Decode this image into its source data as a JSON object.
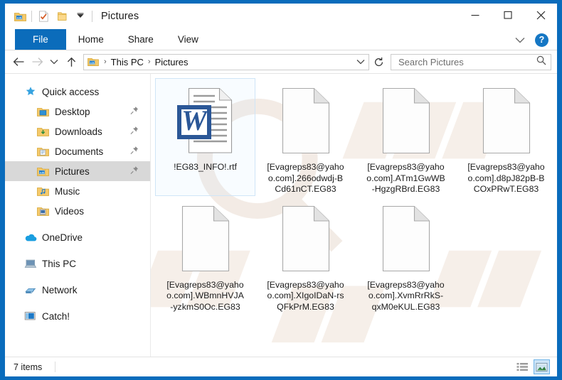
{
  "window": {
    "title": "Pictures",
    "controls": {
      "minimize": "minimize-icon",
      "maximize": "maximize-icon",
      "close": "close-icon"
    },
    "quick_access_toolbar": [
      {
        "name": "pictures-folder-icon",
        "label": "Pictures"
      },
      {
        "name": "properties-icon",
        "label": "Properties"
      },
      {
        "name": "new-folder-icon",
        "label": "New folder"
      },
      {
        "name": "customize-dropdown-icon",
        "label": "Customize Quick Access Toolbar"
      }
    ]
  },
  "ribbon": {
    "tabs": [
      {
        "label": "File",
        "active": true
      },
      {
        "label": "Home",
        "active": false
      },
      {
        "label": "Share",
        "active": false
      },
      {
        "label": "View",
        "active": false
      }
    ],
    "collapse_icon": "chevron-down-icon",
    "help_label": "?"
  },
  "navigation": {
    "back_icon": "arrow-left-icon",
    "forward_icon": "arrow-right-icon",
    "recent_icon": "chevron-down-icon",
    "up_icon": "arrow-up-icon",
    "refresh_icon": "refresh-icon",
    "dropdown_icon": "chevron-down-icon",
    "breadcrumb": [
      {
        "label": "This PC"
      },
      {
        "label": "Pictures"
      }
    ],
    "separator": "›"
  },
  "search": {
    "placeholder": "Search Pictures",
    "value": "",
    "icon": "search-icon"
  },
  "sidebar": {
    "items": [
      {
        "label": "Quick access",
        "icon": "star-icon",
        "indent": false,
        "pinned": false,
        "selected": false
      },
      {
        "label": "Desktop",
        "icon": "desktop-folder-icon",
        "indent": true,
        "pinned": true,
        "selected": false
      },
      {
        "label": "Downloads",
        "icon": "downloads-folder-icon",
        "indent": true,
        "pinned": true,
        "selected": false
      },
      {
        "label": "Documents",
        "icon": "documents-folder-icon",
        "indent": true,
        "pinned": true,
        "selected": false
      },
      {
        "label": "Pictures",
        "icon": "pictures-folder-icon",
        "indent": true,
        "pinned": true,
        "selected": true
      },
      {
        "label": "Music",
        "icon": "music-folder-icon",
        "indent": true,
        "pinned": false,
        "selected": false
      },
      {
        "label": "Videos",
        "icon": "videos-folder-icon",
        "indent": true,
        "pinned": false,
        "selected": false
      },
      {
        "label": "OneDrive",
        "icon": "onedrive-cloud-icon",
        "indent": false,
        "pinned": false,
        "selected": false,
        "gap_before": true
      },
      {
        "label": "This PC",
        "icon": "this-pc-icon",
        "indent": false,
        "pinned": false,
        "selected": false,
        "gap_before": true
      },
      {
        "label": "Network",
        "icon": "network-icon",
        "indent": false,
        "pinned": false,
        "selected": false,
        "gap_before": true
      },
      {
        "label": "Catch!",
        "icon": "catch-media-icon",
        "indent": false,
        "pinned": false,
        "selected": false,
        "gap_before": true
      }
    ]
  },
  "files": [
    {
      "name": "!EG83_INFO!.rtf",
      "icon": "word-rtf-document-icon",
      "selected": true
    },
    {
      "name": "[Evagreps83@yahoo.com].266odwdj-BCd61nCT.EG83",
      "icon": "blank-file-icon",
      "selected": false
    },
    {
      "name": "[Evagreps83@yahoo.com].ATm1GwWB-HgzgRBrd.EG83",
      "icon": "blank-file-icon",
      "selected": false
    },
    {
      "name": "[Evagreps83@yahoo.com].d8pJ82pB-BCOxPRwT.EG83",
      "icon": "blank-file-icon",
      "selected": false
    },
    {
      "name": "[Evagreps83@yahoo.com].WBmnHVJA-yzkmS0Oc.EG83",
      "icon": "blank-file-icon",
      "selected": false
    },
    {
      "name": "[Evagreps83@yahoo.com].XIgoIDaN-rsQFkPrM.EG83",
      "icon": "blank-file-icon",
      "selected": false
    },
    {
      "name": "[Evagreps83@yahoo.com].XvmRrRkS-qxM0eKUL.EG83",
      "icon": "blank-file-icon",
      "selected": false
    }
  ],
  "statusbar": {
    "item_count": "7 items",
    "view_buttons": [
      {
        "name": "details-view-icon",
        "active": false
      },
      {
        "name": "large-icons-view-icon",
        "active": true
      }
    ]
  },
  "colors": {
    "accent": "#0b6cbb",
    "window_border": "#0a6cbc",
    "selection": "#d8d8d8",
    "word_blue": "#2b5797"
  }
}
